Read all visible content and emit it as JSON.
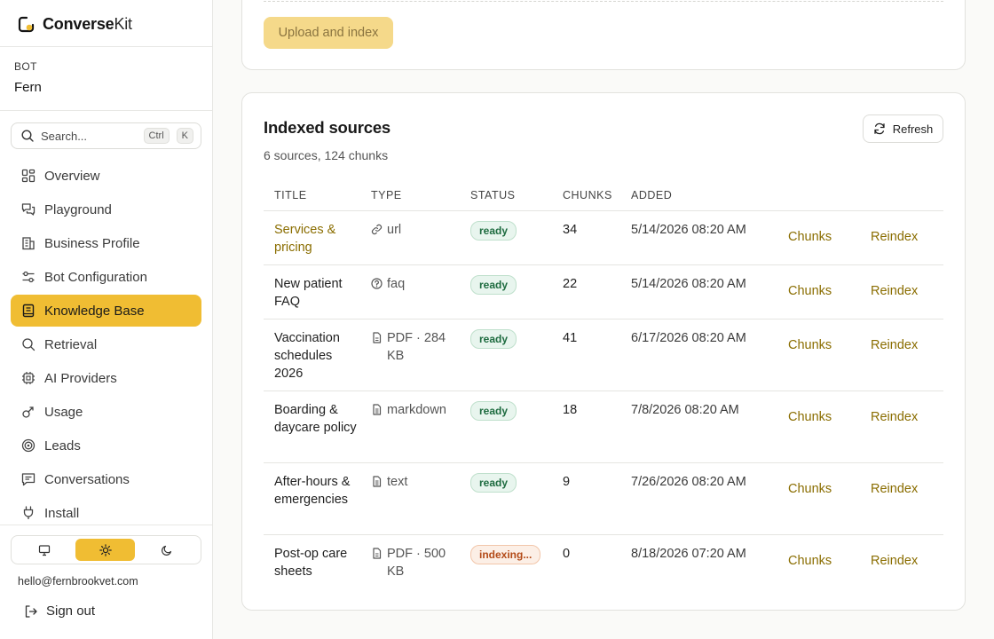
{
  "brand": {
    "name_bold": "Converse",
    "name_light": "Kit"
  },
  "bot": {
    "label": "BOT",
    "name": "Fern"
  },
  "search": {
    "placeholder": "Search...",
    "key1": "Ctrl",
    "key2": "K"
  },
  "nav": [
    {
      "label": "Overview",
      "icon": "grid-icon",
      "active": false
    },
    {
      "label": "Playground",
      "icon": "chat-icon",
      "active": false
    },
    {
      "label": "Business Profile",
      "icon": "building-icon",
      "active": false
    },
    {
      "label": "Bot Configuration",
      "icon": "sliders-icon",
      "active": false
    },
    {
      "label": "Knowledge Base",
      "icon": "book-icon",
      "active": true
    },
    {
      "label": "Retrieval",
      "icon": "search-icon",
      "active": false
    },
    {
      "label": "AI Providers",
      "icon": "chip-icon",
      "active": false
    },
    {
      "label": "Usage",
      "icon": "chart-icon",
      "active": false
    },
    {
      "label": "Leads",
      "icon": "target-icon",
      "active": false
    },
    {
      "label": "Conversations",
      "icon": "message-icon",
      "active": false
    },
    {
      "label": "Install",
      "icon": "plug-icon",
      "active": false
    }
  ],
  "theme": {
    "selected": "light"
  },
  "user": {
    "email": "hello@fernbrookvet.com",
    "signout": "Sign out"
  },
  "upload": {
    "button": "Upload and index"
  },
  "sources": {
    "title": "Indexed sources",
    "subtitle": "6 sources, 124 chunks",
    "refresh": "Refresh",
    "columns": {
      "title": "TITLE",
      "type": "TYPE",
      "status": "STATUS",
      "chunks": "CHUNKS",
      "added": "ADDED"
    },
    "rows": [
      {
        "title": "Services & pricing",
        "type": "url",
        "type_icon": "link-icon",
        "status": "ready",
        "chunks": "34",
        "added": "5/14/2026 08:20 AM",
        "action1": "Chunks",
        "action2": "Reindex"
      },
      {
        "title": "New patient FAQ",
        "type": "faq",
        "type_icon": "question-icon",
        "status": "ready",
        "chunks": "22",
        "added": "5/14/2026 08:20 AM",
        "action1": "Chunks",
        "action2": "Reindex"
      },
      {
        "title": "Vaccination schedules 2026",
        "type": "PDF · 284 KB",
        "type_icon": "pdf-icon",
        "status": "ready",
        "chunks": "41",
        "added": "6/17/2026 08:20 AM",
        "action1": "Chunks",
        "action2": "Reindex"
      },
      {
        "title": "Boarding & daycare policy",
        "type": "markdown",
        "type_icon": "doc-icon",
        "status": "ready",
        "chunks": "18",
        "added": "7/8/2026 08:20 AM",
        "action1": "Chunks",
        "action2": "Reindex"
      },
      {
        "title": "After-hours & emergencies",
        "type": "text",
        "type_icon": "doc-icon",
        "status": "ready",
        "chunks": "9",
        "added": "7/26/2026 08:20 AM",
        "action1": "Chunks",
        "action2": "Reindex"
      },
      {
        "title": "Post-op care sheets",
        "type": "PDF · 500 KB",
        "type_icon": "pdf-icon",
        "status": "indexing...",
        "chunks": "0",
        "added": "8/18/2026 07:20 AM",
        "action1": "Chunks",
        "action2": "Reindex"
      }
    ]
  },
  "colors": {
    "accent": "#f0bd33",
    "link": "#8a6d00",
    "ready": "#1d6b3f",
    "indexing": "#b34a17"
  }
}
